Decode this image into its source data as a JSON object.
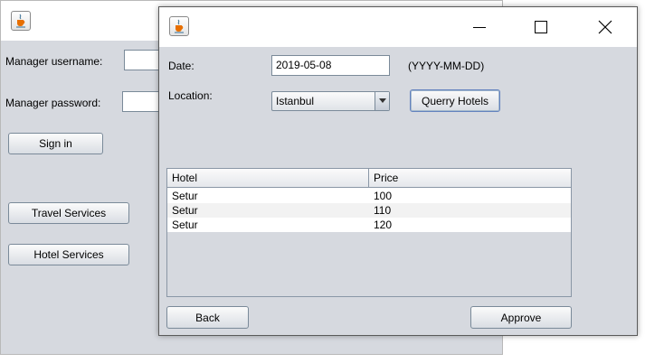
{
  "background_window": {
    "fields": {
      "username_label": "Manager username:",
      "password_label": "Manager password:"
    },
    "buttons": {
      "sign_in": "Sign in",
      "travel_services": "Travel Services",
      "hotel_services": "Hotel Services"
    }
  },
  "hotel_window": {
    "titlebar": {
      "icon": "java-cup-icon",
      "minimize": "minimize-icon",
      "maximize": "maximize-icon",
      "close": "close-icon"
    },
    "date": {
      "label": "Date:",
      "value": "2019-05-08",
      "hint": "(YYYY-MM-DD)"
    },
    "location": {
      "label": "Location:",
      "selected": "Istanbul"
    },
    "query_button": "Querry Hotels",
    "table": {
      "columns": [
        "Hotel",
        "Price"
      ],
      "rows": [
        [
          "Setur",
          "100"
        ],
        [
          "Setur",
          "110"
        ],
        [
          "Setur",
          "120"
        ]
      ]
    },
    "back_button": "Back",
    "approve_button": "Approve"
  }
}
